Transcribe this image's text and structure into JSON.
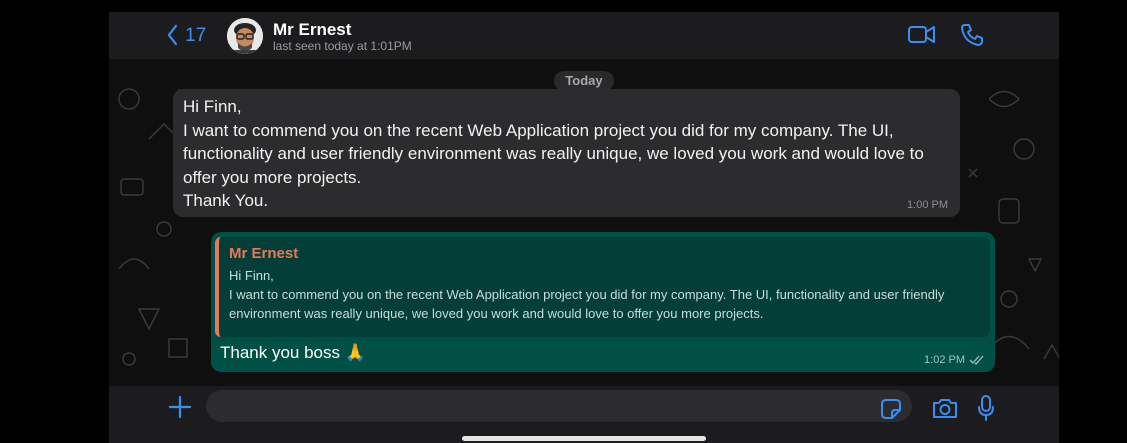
{
  "header": {
    "back_count": "17",
    "contact_name": "Mr Ernest",
    "contact_status": "last seen today at 1:01PM"
  },
  "chat": {
    "date_separator": "Today",
    "incoming": {
      "text": "Hi Finn,\nI want to commend you on the recent Web Application project you did for my company. The UI, functionality and user friendly environment was really unique, we loved you work and would love to offer you more projects.\nThank You.",
      "time": "1:00 PM"
    },
    "outgoing": {
      "quoted_sender": "Mr Ernest",
      "quoted_text": "Hi Finn,\nI want to commend you on the recent Web Application project you did for my company. The UI, functionality and user friendly environment was really unique, we loved you work and would love to offer you more projects.",
      "text": "Thank you boss 🙏",
      "time": "1:02 PM",
      "status": "read"
    }
  },
  "input": {
    "value": "",
    "placeholder": ""
  },
  "colors": {
    "accent": "#3a8ef0",
    "outgoing_bubble": "#005046",
    "quote_accent": "#e9785b",
    "incoming_bubble": "#2c2c2e"
  },
  "icons": [
    "chevron-left-icon",
    "video-call-icon",
    "phone-icon",
    "plus-icon",
    "sticker-icon",
    "camera-icon",
    "microphone-icon",
    "double-check-icon"
  ]
}
